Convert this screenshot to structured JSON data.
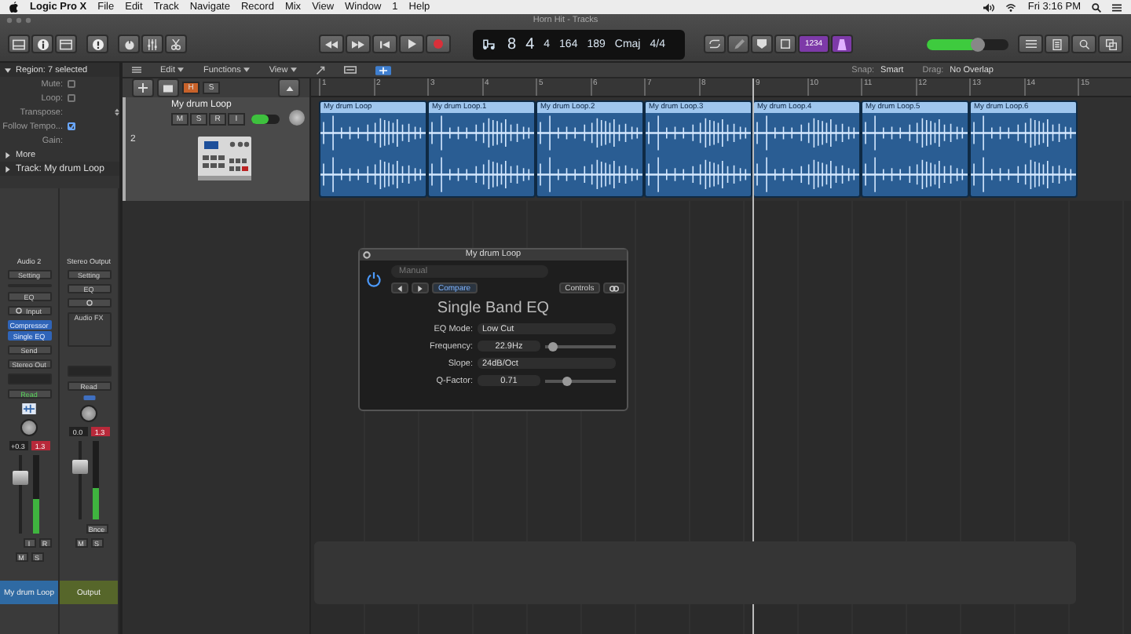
{
  "menubar": {
    "app": "Logic Pro X",
    "menus": [
      "File",
      "Edit",
      "Track",
      "Navigate",
      "Record",
      "Mix",
      "View",
      "Window",
      "1",
      "Help"
    ],
    "clock": "Fri 3:16 PM"
  },
  "window": {
    "title": "Horn Hit - Tracks"
  },
  "lcd": {
    "bar": "8",
    "beat": "4",
    "division": "4",
    "tick": "164",
    "tempo": "189",
    "key": "Cmaj",
    "signature": "4/4"
  },
  "count_in": "1234",
  "master_volume": {
    "level": 0.62
  },
  "inspector": {
    "region_header": "Region: 7 selected",
    "fields": [
      {
        "label": "Mute:",
        "kind": "checkbox",
        "checked": false
      },
      {
        "label": "Loop:",
        "kind": "checkbox",
        "checked": false
      },
      {
        "label": "Transpose:",
        "kind": "stepper"
      },
      {
        "label": "Follow Tempo...",
        "kind": "checkbox",
        "checked": true
      },
      {
        "label": "Gain:",
        "kind": "plain"
      }
    ],
    "more": "More",
    "track_header": "Track:  My drum Loop"
  },
  "strips": [
    {
      "name": "Audio 2",
      "setting": "Setting",
      "eq": "EQ",
      "input": "Input",
      "plugins": [
        "Compressor",
        "Single EQ"
      ],
      "send": "Send",
      "output": "Stereo Out",
      "automation": "Read",
      "automation_active": true,
      "volume": "+0.3",
      "peak": "1.3",
      "fader": {
        "level": 0.7
      },
      "meter": {
        "level": 0.45
      },
      "buttons_top": [
        "I",
        "R"
      ],
      "buttons_bottom": [
        "M",
        "S"
      ],
      "footer": "My drum Loop",
      "color": "#2f6aa3"
    },
    {
      "name": "Stereo Output",
      "setting": "Setting",
      "eq": "EQ",
      "audio_fx": "Audio FX",
      "automation": "Read",
      "automation_active": false,
      "volume": "0.0",
      "peak": "1.3",
      "fader": {
        "level": 0.66
      },
      "meter": {
        "level": 0.4
      },
      "buttons_top": [
        "Bnce"
      ],
      "buttons_bottom": [
        "M",
        "S"
      ],
      "footer": "Output",
      "color": "#56662a"
    }
  ],
  "tracks_toolbar": {
    "menus": [
      "Edit",
      "Functions",
      "View"
    ],
    "snap_label": "Snap:",
    "snap": "Smart",
    "drag_label": "Drag:",
    "drag": "No Overlap"
  },
  "header_buttons": [
    {
      "label": "H",
      "on": true
    },
    {
      "label": "S",
      "on": false
    }
  ],
  "ruler": [
    "1",
    "2",
    "3",
    "4",
    "5",
    "6",
    "7",
    "8",
    "9",
    "10",
    "11",
    "12",
    "13",
    "14",
    "15"
  ],
  "track": {
    "number": "2",
    "name": "My drum Loop",
    "buttons": [
      "M",
      "S",
      "R",
      "I"
    ],
    "volume": {
      "level": 0.6
    }
  },
  "regions": [
    {
      "name": "My drum Loop",
      "selected": true
    },
    {
      "name": "My drum Loop.1",
      "selected": true
    },
    {
      "name": "My drum Loop.2",
      "selected": true
    },
    {
      "name": "My drum Loop.3",
      "selected": true
    },
    {
      "name": "My drum Loop.4",
      "selected": true
    },
    {
      "name": "My drum Loop.5",
      "selected": true
    },
    {
      "name": "My drum Loop.6",
      "selected": true
    }
  ],
  "plugin": {
    "title": "My drum Loop",
    "power": true,
    "preset": "Manual",
    "compare": "Compare",
    "controls": "Controls",
    "heading": "Single Band EQ",
    "params": [
      {
        "label": "EQ Mode:",
        "kind": "menu",
        "value": "Low Cut"
      },
      {
        "label": "Frequency:",
        "kind": "slider",
        "value": "22.9Hz",
        "level": 0.12
      },
      {
        "label": "Slope:",
        "kind": "menu",
        "value": "24dB/Oct"
      },
      {
        "label": "Q-Factor:",
        "kind": "slider",
        "value": "0.71",
        "level": 0.3
      }
    ]
  }
}
